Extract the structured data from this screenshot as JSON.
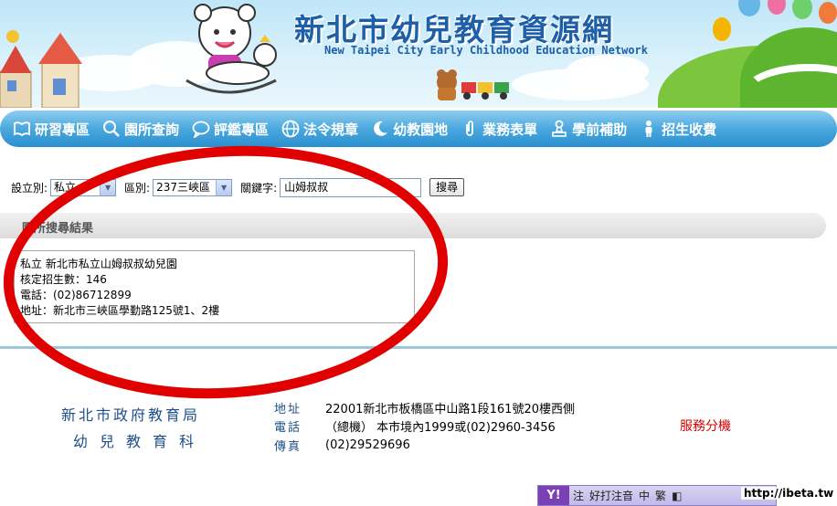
{
  "header": {
    "title": "新北市幼兒教育資源網",
    "subtitle": "New Taipei City Early Childhood Education Network"
  },
  "nav": {
    "items": [
      {
        "label": "研習專區",
        "icon": "book-icon"
      },
      {
        "label": "園所查詢",
        "icon": "magnifier-icon"
      },
      {
        "label": "評鑑專區",
        "icon": "speech-bubble-icon"
      },
      {
        "label": "法令規章",
        "icon": "globe-icon"
      },
      {
        "label": "幼教園地",
        "icon": "moon-icon"
      },
      {
        "label": "業務表單",
        "icon": "paperclip-icon"
      },
      {
        "label": "學前補助",
        "icon": "stamp-icon"
      },
      {
        "label": "招生收費",
        "icon": "person-icon"
      }
    ]
  },
  "search": {
    "type_label": "設立別:",
    "type_value": "私立",
    "district_label": "區別:",
    "district_value": "237三峽區",
    "keyword_label": "關鍵字:",
    "keyword_value": "山姆叔叔",
    "button_label": "搜尋"
  },
  "results": {
    "title": "園所搜尋結果",
    "items": [
      {
        "name_line": "私立  新北市私立山姆叔叔幼兒園",
        "capacity_line": "核定招生數：146",
        "phone_line": "電話：(02)86712899",
        "address_line": "地址：新北市三峽區學勤路125號1、2樓"
      }
    ]
  },
  "footer": {
    "org": "新北市政府教育局",
    "dept": "幼兒教育科",
    "address_label": "地址",
    "address_value": "22001新北市板橋區中山路1段161號20樓西側",
    "phone_label": "電話",
    "phone_value": "（總機） 本市境內1999或(02)2960-3456",
    "fax_label": "傳真",
    "fax_value": "(02)29529696",
    "service_ext": "服務分機"
  },
  "ime": {
    "logo": "Y!",
    "mode": "注",
    "text": "好打注音",
    "lang": "中",
    "charset": "繁"
  },
  "watermark": "http://ibeta.tw",
  "colors": {
    "title_blue": "#1d5fa8",
    "nav_blue": "#2b8fcf",
    "annotation_red": "#e00000",
    "service_red": "#d40000"
  }
}
